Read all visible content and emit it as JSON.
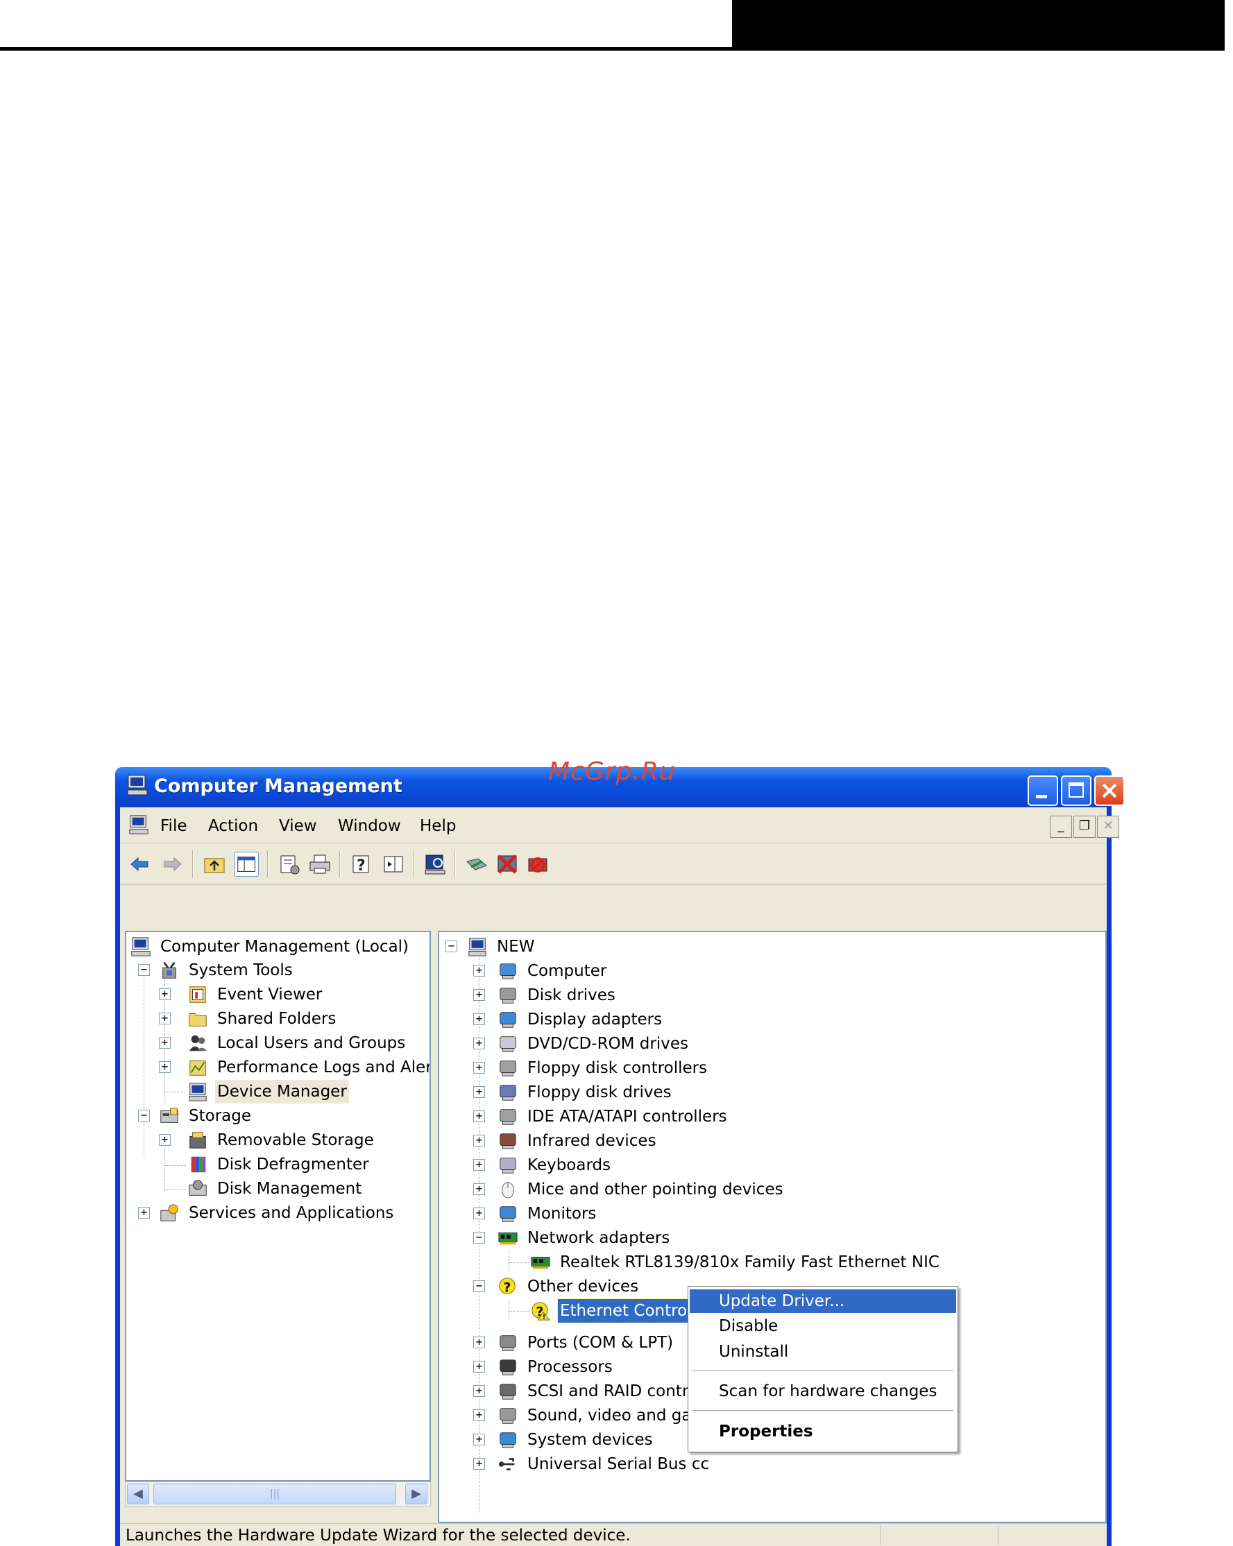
{
  "watermark": "McGrp.Ru",
  "window": {
    "title": "Computer Management"
  },
  "menu": [
    "File",
    "Action",
    "View",
    "Window",
    "Help"
  ],
  "left_tree": [
    {
      "label": "Computer Management (Local)",
      "icon": "computer-icon"
    },
    {
      "label": "System Tools",
      "icon": "tools-icon"
    },
    {
      "label": "Event Viewer",
      "icon": "event-viewer-icon"
    },
    {
      "label": "Shared Folders",
      "icon": "folder-icon"
    },
    {
      "label": "Local Users and Groups",
      "icon": "users-icon"
    },
    {
      "label": "Performance Logs and Alerts",
      "icon": "performance-icon"
    },
    {
      "label": "Device Manager",
      "icon": "device-manager-icon"
    },
    {
      "label": "Storage",
      "icon": "storage-icon"
    },
    {
      "label": "Removable Storage",
      "icon": "removable-storage-icon"
    },
    {
      "label": "Disk Defragmenter",
      "icon": "defrag-icon"
    },
    {
      "label": "Disk Management",
      "icon": "disk-management-icon"
    },
    {
      "label": "Services and Applications",
      "icon": "services-icon"
    }
  ],
  "right_tree": [
    {
      "label": "NEW",
      "icon": "computer-icon"
    },
    {
      "label": "Computer",
      "icon": "computer-icon"
    },
    {
      "label": "Disk drives",
      "icon": "disk-drive-icon"
    },
    {
      "label": "Display adapters",
      "icon": "display-icon"
    },
    {
      "label": "DVD/CD-ROM drives",
      "icon": "cdrom-icon"
    },
    {
      "label": "Floppy disk controllers",
      "icon": "controller-icon"
    },
    {
      "label": "Floppy disk drives",
      "icon": "floppy-icon"
    },
    {
      "label": "IDE ATA/ATAPI controllers",
      "icon": "controller-icon"
    },
    {
      "label": "Infrared devices",
      "icon": "infrared-icon"
    },
    {
      "label": "Keyboards",
      "icon": "keyboard-icon"
    },
    {
      "label": "Mice and other pointing devices",
      "icon": "mouse-icon"
    },
    {
      "label": "Monitors",
      "icon": "monitor-icon"
    },
    {
      "label": "Network adapters",
      "icon": "network-card-icon"
    },
    {
      "label": "Realtek RTL8139/810x Family Fast Ethernet NIC",
      "icon": "network-card-icon"
    },
    {
      "label": "Other devices",
      "icon": "unknown-device-icon"
    },
    {
      "label": "Ethernet Controller",
      "icon": "unknown-device-icon"
    },
    {
      "label": "Ports (COM & LPT)",
      "icon": "port-icon"
    },
    {
      "label": "Processors",
      "icon": "processor-icon"
    },
    {
      "label": "SCSI and RAID contro",
      "icon": "scsi-icon"
    },
    {
      "label": "Sound, video and gam",
      "icon": "sound-icon"
    },
    {
      "label": "System devices",
      "icon": "system-icon"
    },
    {
      "label": "Universal Serial Bus cc",
      "icon": "usb-icon"
    }
  ],
  "context_menu": {
    "update": "Update Driver...",
    "disable": "Disable",
    "uninstall": "Uninstall",
    "scan": "Scan for hardware changes",
    "properties": "Properties"
  },
  "status": "Launches the Hardware Update Wizard for the selected device.",
  "colors": {
    "title_blue": "#0a48d6",
    "selection": "#316ac5",
    "chrome": "#ece9d8"
  }
}
